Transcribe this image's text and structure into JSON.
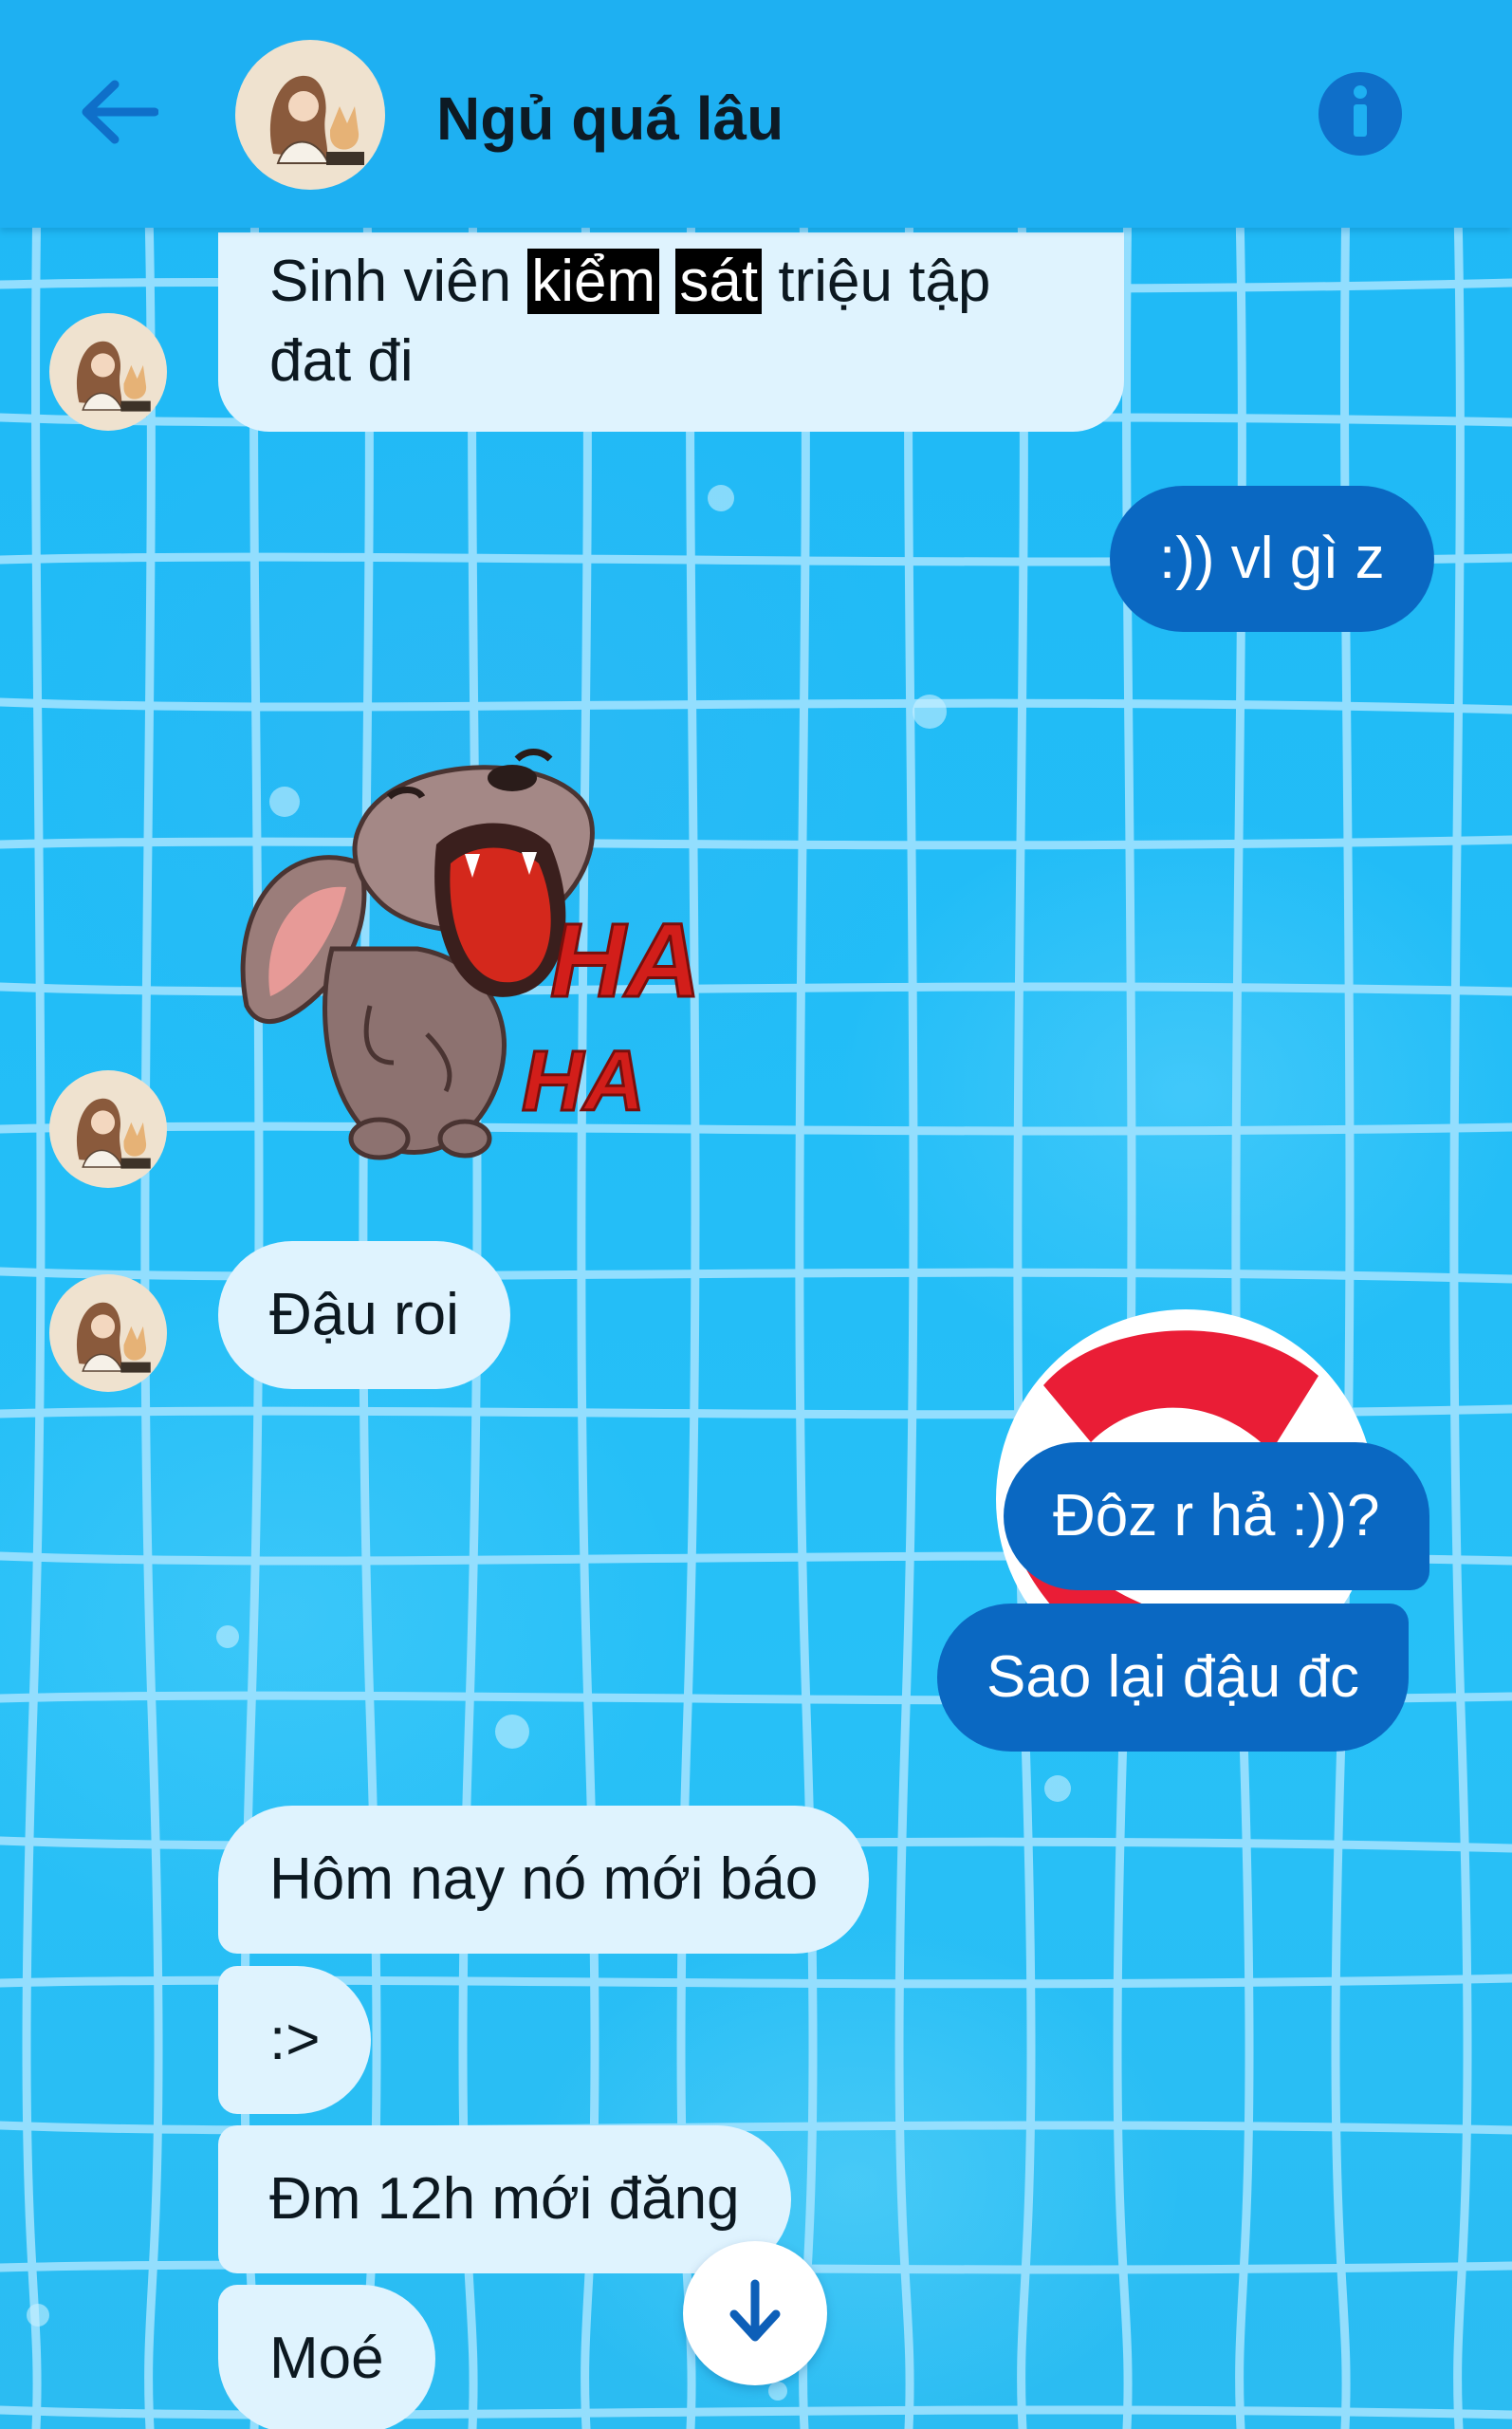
{
  "header": {
    "title": "Ngủ quá lâu",
    "back_icon": "arrow-left-icon",
    "info_icon": "info-icon"
  },
  "colors": {
    "header_bg": "#1eb0f2",
    "incoming_bubble": "#dff3fe",
    "outgoing_bubble": "#0a68c2",
    "pool_bg": "#14b3f3"
  },
  "messages": [
    {
      "from": "them",
      "parts": [
        "Sinh viên ",
        "kiểm",
        " ",
        "sát",
        " triệu tập"
      ],
      "line2": "đat đi"
    },
    {
      "from": "me",
      "text": ":)) vl gì z"
    },
    {
      "from": "them",
      "type": "sticker",
      "sticker_text_1": "HA",
      "sticker_text_2": "HA"
    },
    {
      "from": "them",
      "text": "Đậu roi"
    },
    {
      "from": "me",
      "text": "Đôz r hả :))?"
    },
    {
      "from": "me",
      "text": "Sao lại đậu đc"
    },
    {
      "from": "them",
      "text": "Hôm nay nó mới báo"
    },
    {
      "from": "them",
      "text": ":>"
    },
    {
      "from": "them",
      "text": "Đm 12h mới đăng"
    },
    {
      "from": "them",
      "text": "Moé"
    }
  ],
  "scroll_down_icon": "arrow-down-icon"
}
